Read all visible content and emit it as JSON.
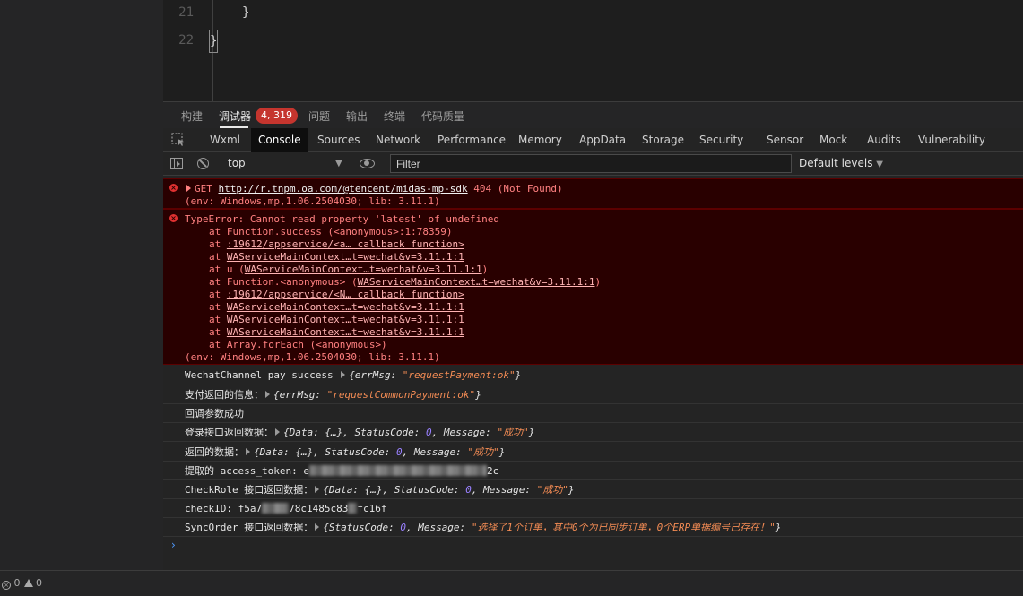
{
  "editor": {
    "lines": [
      {
        "no": "21",
        "code": "}"
      },
      {
        "no": "22",
        "code": "}"
      }
    ]
  },
  "panel_tabs": {
    "items": [
      "构建",
      "调试器",
      "问题",
      "输出",
      "终端",
      "代码质量"
    ],
    "active": "调试器",
    "error_badge": "4, 319"
  },
  "devtools_tabs": {
    "items": [
      "Wxml",
      "Console",
      "Sources",
      "Network",
      "Performance",
      "Memory",
      "AppData",
      "Storage",
      "Security",
      "Sensor",
      "Mock",
      "Audits",
      "Vulnerability"
    ],
    "active": "Console"
  },
  "console_toolbar": {
    "context": "top",
    "filter_placeholder": "Filter",
    "levels": "Default levels"
  },
  "console": {
    "error1": {
      "method": "GET",
      "url": "http://r.tnpm.oa.com/@tencent/midas-mp-sdk",
      "status": "404 (Not Found)",
      "env": "(env: Windows,mp,1.06.2504030; lib: 3.11.1)"
    },
    "error2": {
      "message": "TypeError: Cannot read property 'latest' of undefined",
      "at": "at",
      "frames": [
        {
          "pre": "Function.success (<anonymous>:1:78359)",
          "link": "",
          "post": ""
        },
        {
          "pre": "",
          "link": ":19612/appservice/<a… callback function>",
          "post": ""
        },
        {
          "pre": "",
          "link": "WAServiceMainContext…t=wechat&v=3.11.1:1",
          "post": ""
        },
        {
          "pre": "u (",
          "link": "WAServiceMainContext…t=wechat&v=3.11.1:1",
          "post": ")"
        },
        {
          "pre": "Function.<anonymous> (",
          "link": "WAServiceMainContext…t=wechat&v=3.11.1:1",
          "post": ")"
        },
        {
          "pre": "",
          "link": ":19612/appservice/<N… callback function>",
          "post": ""
        },
        {
          "pre": "",
          "link": "WAServiceMainContext…t=wechat&v=3.11.1:1",
          "post": ""
        },
        {
          "pre": "",
          "link": "WAServiceMainContext…t=wechat&v=3.11.1:1",
          "post": ""
        },
        {
          "pre": "",
          "link": "WAServiceMainContext…t=wechat&v=3.11.1:1",
          "post": ""
        },
        {
          "pre": "Array.forEach (<anonymous>)",
          "link": "",
          "post": ""
        }
      ],
      "env": "(env: Windows,mp,1.06.2504030; lib: 3.11.1)"
    },
    "logs": {
      "pay_success": {
        "label": "WechatChannel pay success ",
        "o1": "{errMsg: ",
        "s1": "\"requestPayment:ok\"",
        "o2": "}"
      },
      "pay_return": {
        "label": "支付返回的信息：",
        "o1": "{errMsg: ",
        "s1": "\"requestCommonPayment:ok\"",
        "o2": "}"
      },
      "callback_ok": {
        "label": "回调参数成功"
      },
      "login_data": {
        "label": "登录接口返回数据：",
        "o1": "{Data: {…}, StatusCode: ",
        "n1": "0",
        "o2": ", Message: ",
        "s1": "\"成功\"",
        "o3": "}"
      },
      "return_data": {
        "label": "返回的数据：",
        "o1": "{Data: {…}, StatusCode: ",
        "n1": "0",
        "o2": ", Message: ",
        "s1": "\"成功\"",
        "o3": "}"
      },
      "access_token": {
        "label": "提取的 access_token: ",
        "v1": "e",
        "v2": "2c"
      },
      "check_role": {
        "label": "CheckRole 接口返回数据：",
        "o1": "{Data: {…}, StatusCode: ",
        "n1": "0",
        "o2": ", Message: ",
        "s1": "\"成功\"",
        "o3": "}"
      },
      "check_id": {
        "label": "checkID: ",
        "v1": "f5a7",
        "v2": "78c1485c83",
        "v3": "fc16f"
      },
      "sync_order": {
        "label": "SyncOrder 接口返回数据：",
        "o1": "{StatusCode: ",
        "n1": "0",
        "o2": ", Message: ",
        "s1": "\"选择了1个订单，其中0个为已同步订单，0个ERP单据编号已存在！\"",
        "o3": "}"
      }
    },
    "prompt": "›"
  },
  "statusbar": {
    "errors": "0",
    "warnings": "0"
  },
  "colors": {
    "error_bg": "#290000",
    "error_text": "#ff8080",
    "badge": "#c5352e",
    "string": "#f28b54",
    "number": "#9980ff"
  }
}
